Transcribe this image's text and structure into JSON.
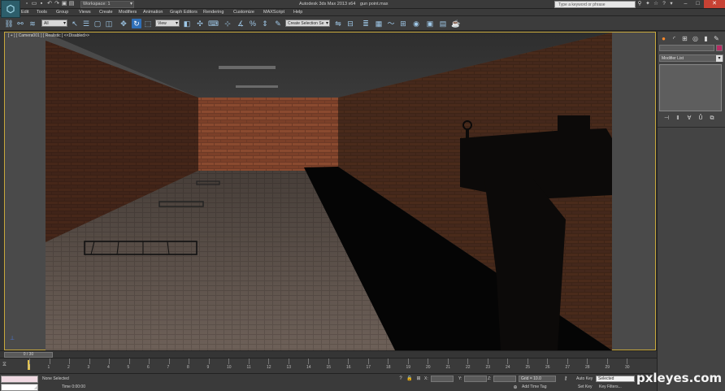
{
  "window": {
    "app_title": "Autodesk 3ds Max  2013 x64",
    "file_name": "gun point.max",
    "workspace": "Workspace: 1",
    "search_placeholder": "Type a keyword or phrase"
  },
  "menu": [
    "Edit",
    "Tools",
    "Group",
    "Views",
    "Create",
    "Modifiers",
    "Animation",
    "Graph Editors",
    "Rendering",
    "Customize",
    "MAXScript",
    "Help"
  ],
  "toolbar": {
    "selection_filter": "All",
    "reference_coord": "View",
    "named_selection": "Create Selection Se"
  },
  "viewport": {
    "label": "[ + ] [ Camera001 ] [ Realistic ]  <<Disabled>>"
  },
  "command_panel": {
    "modifier_list": "Modifier List"
  },
  "timeline": {
    "slider_label": "0 / 30",
    "ticks": [
      "0",
      "1",
      "2",
      "3",
      "4",
      "5",
      "6",
      "7",
      "8",
      "9",
      "10",
      "11",
      "12",
      "13",
      "14",
      "15",
      "16",
      "17",
      "18",
      "19",
      "20",
      "21",
      "22",
      "23",
      "24",
      "25",
      "26",
      "27",
      "28",
      "29",
      "30"
    ]
  },
  "status": {
    "selection": "None Selected",
    "time": "Time  0:00:00",
    "x_label": "X:",
    "y_label": "Y:",
    "z_label": "Z:",
    "grid": "Grid = 10.0",
    "add_time_tag": "Add Time Tag",
    "auto_key": "Auto Key",
    "selected": "Selected",
    "set_key": "Set Key",
    "key_filters": "Key Filters..."
  },
  "watermark": "pxleyes.com",
  "colors": {
    "accent": "#2f6fb7",
    "viewport_border": "#c8a83c",
    "timeline_cursor": "#e3c24b",
    "object_color": "#b52b62"
  }
}
